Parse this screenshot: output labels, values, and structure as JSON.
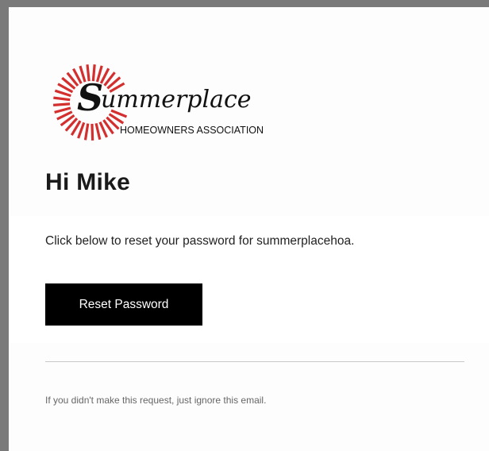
{
  "logo": {
    "brand_name": "Summerplace",
    "subtitle": "HOMEOWNERS ASSOCIATION",
    "ray_color": "#d32f2f"
  },
  "email": {
    "greeting": "Hi Mike",
    "message": "Click below to reset your password for summerplacehoa.",
    "button_label": "Reset Password",
    "footnote": "If you didn't make this request, just ignore this email."
  },
  "colors": {
    "button_bg": "#000000",
    "button_text": "#ffffff"
  }
}
